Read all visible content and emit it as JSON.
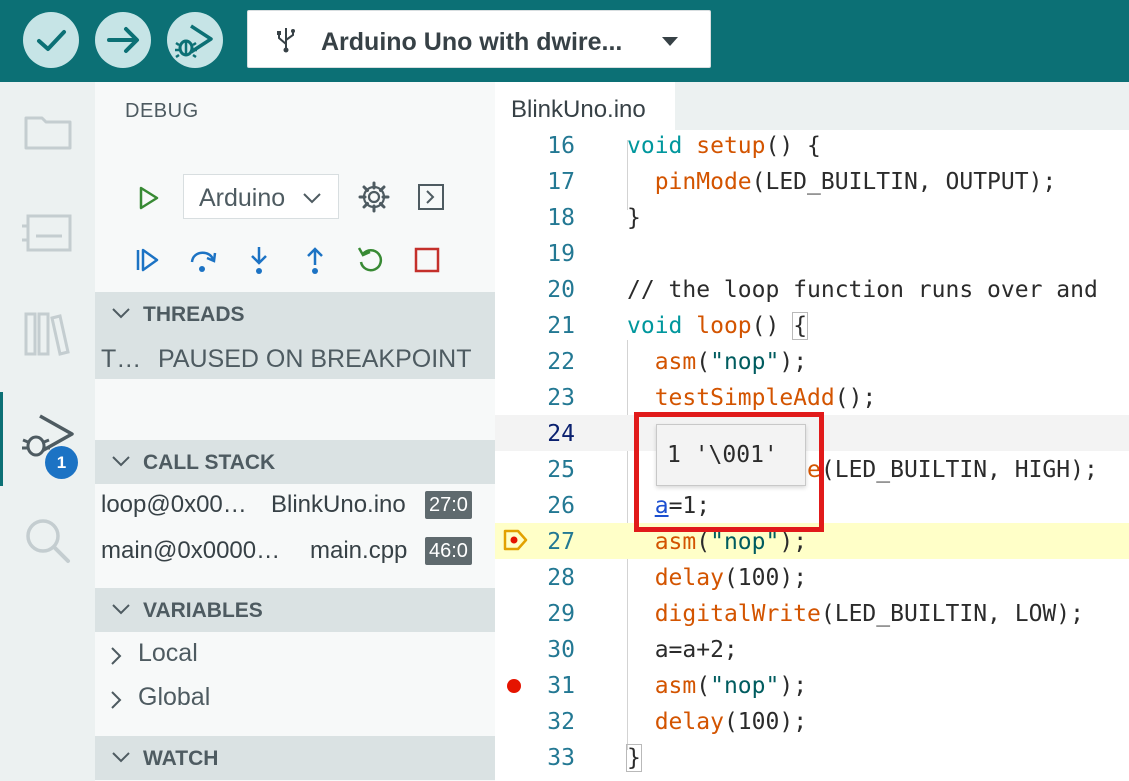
{
  "toolbar": {
    "verify": "verify-icon",
    "upload": "upload-icon",
    "debug": "debug-icon",
    "board": "Arduino Uno with dwire..."
  },
  "activity": {
    "items": [
      "folder-icon",
      "board-manager-icon",
      "library-icon",
      "debug-icon",
      "search-icon"
    ],
    "badge": "1"
  },
  "sidebar": {
    "title": "DEBUG",
    "config": "Arduino",
    "sections": {
      "threads": "THREADS",
      "call_stack": "CALL STACK",
      "variables": "VARIABLES",
      "watch": "WATCH"
    },
    "thread": {
      "name": "T…",
      "state": "PAUSED ON BREAKPOINT"
    },
    "stack": [
      {
        "fn": "loop@0x00…",
        "file": "BlinkUno.ino",
        "pos": "27:0"
      },
      {
        "fn": "main@0x0000…",
        "file": "main.cpp",
        "pos": "46:0"
      }
    ],
    "variables": [
      "Local",
      "Global"
    ]
  },
  "editor": {
    "tab": "BlinkUno.ino",
    "hover_value": "1 '\\001'",
    "lines": [
      {
        "n": "16",
        "t": "void setup() {"
      },
      {
        "n": "17",
        "t": "  pinMode(LED_BUILTIN, OUTPUT);"
      },
      {
        "n": "18",
        "t": "}"
      },
      {
        "n": "19",
        "t": ""
      },
      {
        "n": "20",
        "t": "// the loop function runs over and"
      },
      {
        "n": "21",
        "t": "void loop() {"
      },
      {
        "n": "22",
        "t": "  asm(\"nop\");"
      },
      {
        "n": "23",
        "t": "  testSimpleAdd();"
      },
      {
        "n": "24",
        "t": ""
      },
      {
        "n": "25",
        "t": "  digitalWrite(LED_BUILTIN, HIGH);"
      },
      {
        "n": "26",
        "t": "  a=1;"
      },
      {
        "n": "27",
        "t": "  asm(\"nop\");"
      },
      {
        "n": "28",
        "t": "  delay(100);"
      },
      {
        "n": "29",
        "t": "  digitalWrite(LED_BUILTIN, LOW);"
      },
      {
        "n": "30",
        "t": "  a=a+2;"
      },
      {
        "n": "31",
        "t": "  asm(\"nop\");"
      },
      {
        "n": "32",
        "t": "  delay(100);"
      },
      {
        "n": "33",
        "t": "}"
      }
    ]
  }
}
